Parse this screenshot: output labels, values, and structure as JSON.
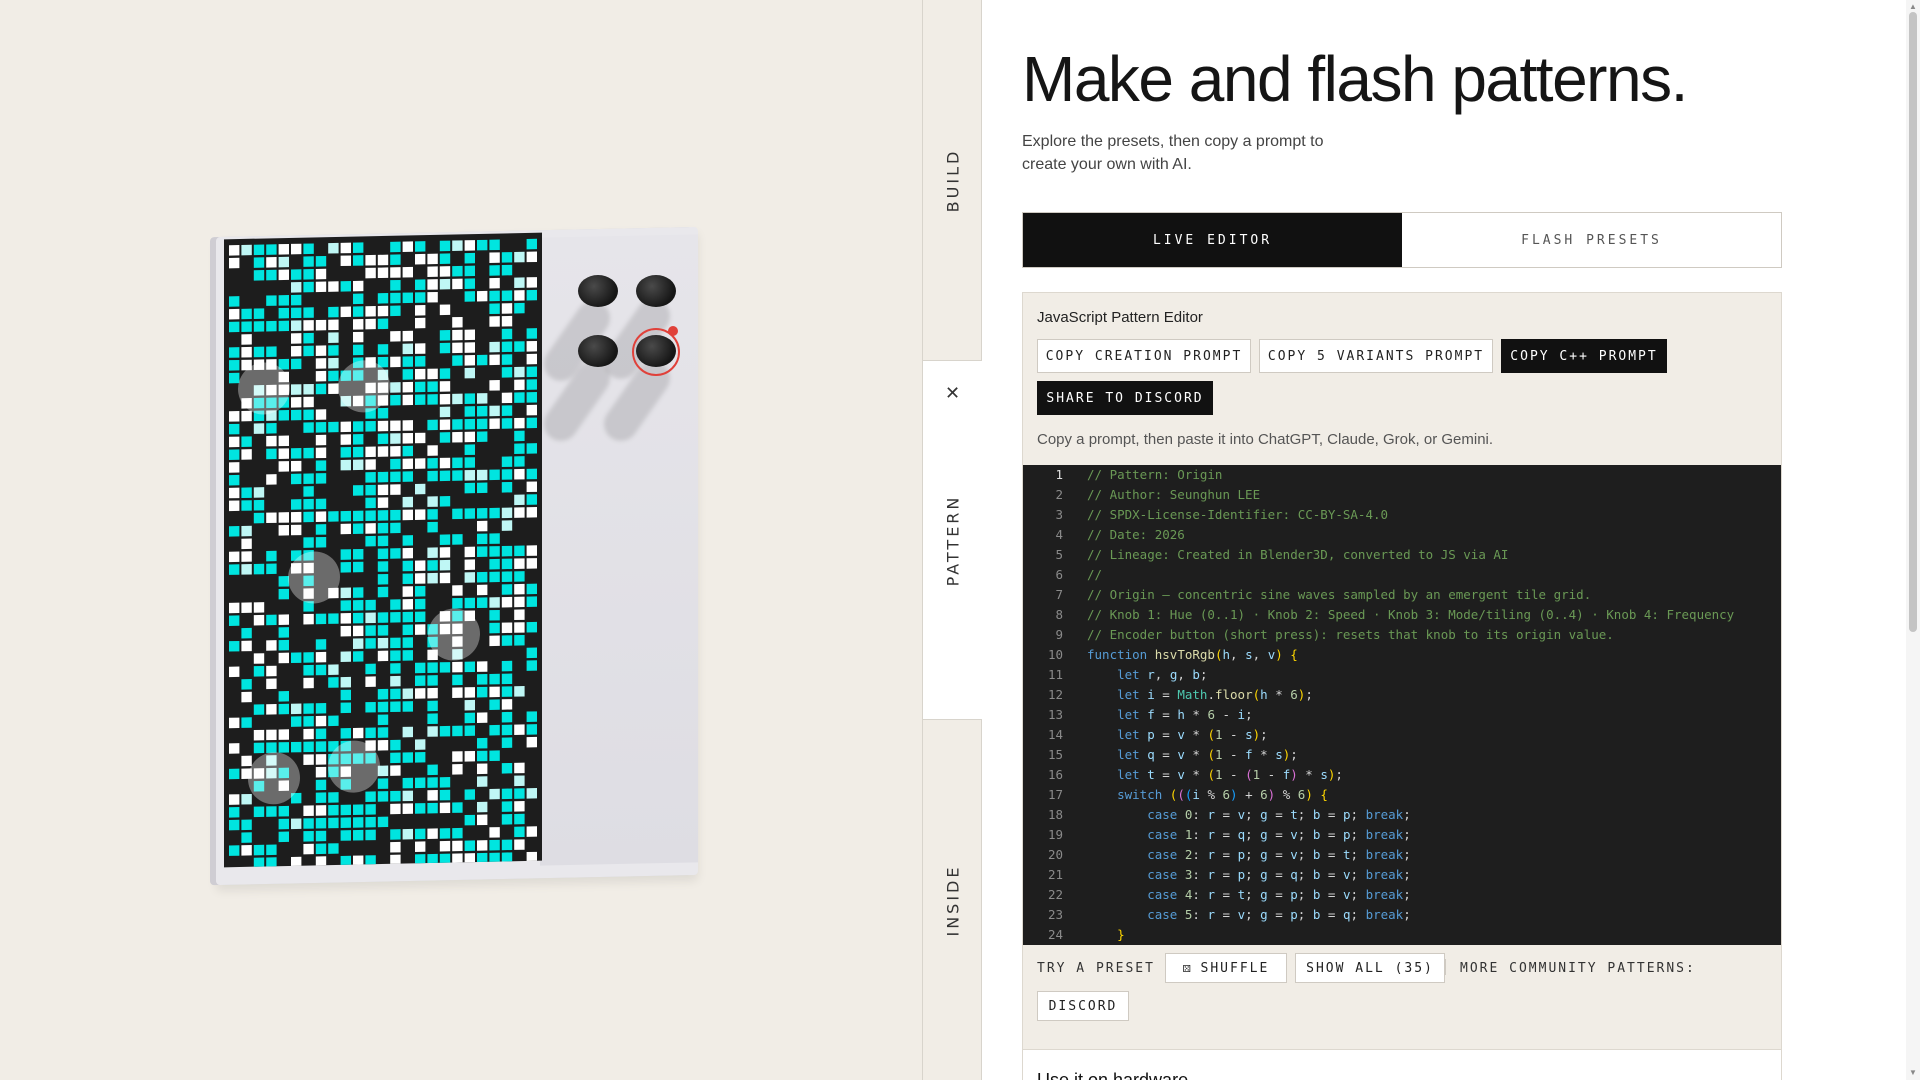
{
  "nav": {
    "build": "BUILD",
    "pattern": "PATTERN",
    "inside": "INSIDE",
    "close_icon": "close-icon"
  },
  "header": {
    "title": "Make and flash patterns.",
    "subtitle": "Explore the presets, then copy a prompt to create your own with AI."
  },
  "tabs": [
    {
      "label": "LIVE EDITOR",
      "active": true
    },
    {
      "label": "FLASH PRESETS",
      "active": false
    }
  ],
  "editor": {
    "title": "JavaScript Pattern Editor",
    "buttons": {
      "copy_creation": "COPY CREATION PROMPT",
      "copy_variants": "COPY 5 VARIANTS PROMPT",
      "copy_cpp": "COPY C++ PROMPT",
      "share_discord": "SHARE TO DISCORD"
    },
    "hint": "Copy a prompt, then paste it into ChatGPT, Claude, Grok, or Gemini.",
    "current_line": 1,
    "code_lines": [
      "// Pattern: Origin",
      "// Author: Seunghun LEE",
      "// SPDX-License-Identifier: CC-BY-SA-4.0",
      "// Date: 2026",
      "// Lineage: Created in Blender3D, converted to JS via AI",
      "//",
      "// Origin — concentric sine waves sampled by an emergent tile grid.",
      "// Knob 1: Hue (0..1) · Knob 2: Speed · Knob 3: Mode/tiling (0..4) · Knob 4: Frequency",
      "// Encoder button (short press): resets that knob to its origin value.",
      "function hsvToRgb(h, s, v) {",
      "    let r, g, b;",
      "    let i = Math.floor(h * 6);",
      "    let f = h * 6 - i;",
      "    let p = v * (1 - s);",
      "    let q = v * (1 - f * s);",
      "    let t = v * (1 - (1 - f) * s);",
      "    switch (((i % 6) + 6) % 6) {",
      "        case 0: r = v; g = t; b = p; break;",
      "        case 1: r = q; g = v; b = p; break;",
      "        case 2: r = p; g = v; b = t; break;",
      "        case 3: r = p; g = q; b = v; break;",
      "        case 4: r = t; g = p; b = v; break;",
      "        case 5: r = v; g = p; b = q; break;",
      "    }"
    ]
  },
  "presets": {
    "try_label": "TRY A PRESET",
    "shuffle_icon": "dice-icon",
    "shuffle": "SHUFFLE",
    "show_all": "SHOW ALL (35)",
    "community_label": "MORE COMMUNITY PATTERNS:",
    "discord": "DISCORD"
  },
  "hardware": {
    "title": "Use it on hardware"
  },
  "colors": {
    "accent_cyan": "#00e5e0",
    "knob_highlight": "#e0413a",
    "panel_bg": "#f1ede6",
    "dark": "#111111"
  }
}
